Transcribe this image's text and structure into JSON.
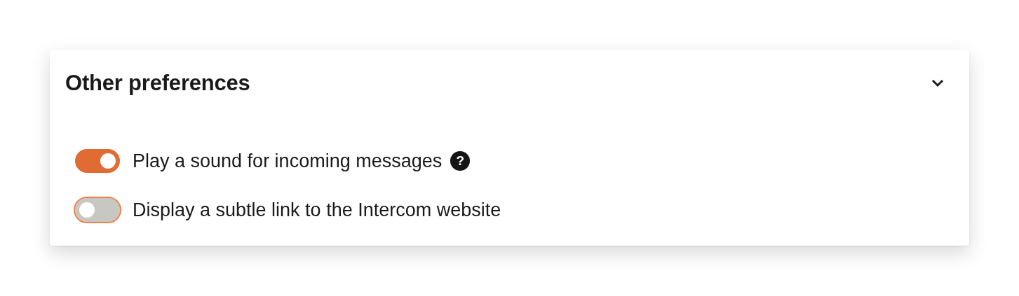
{
  "panel": {
    "title": "Other preferences",
    "expanded": true,
    "settings": [
      {
        "label": "Play a sound for incoming messages",
        "on": true,
        "focused": false,
        "help": "?"
      },
      {
        "label": "Display a subtle link to the Intercom website",
        "on": false,
        "focused": true
      }
    ]
  }
}
